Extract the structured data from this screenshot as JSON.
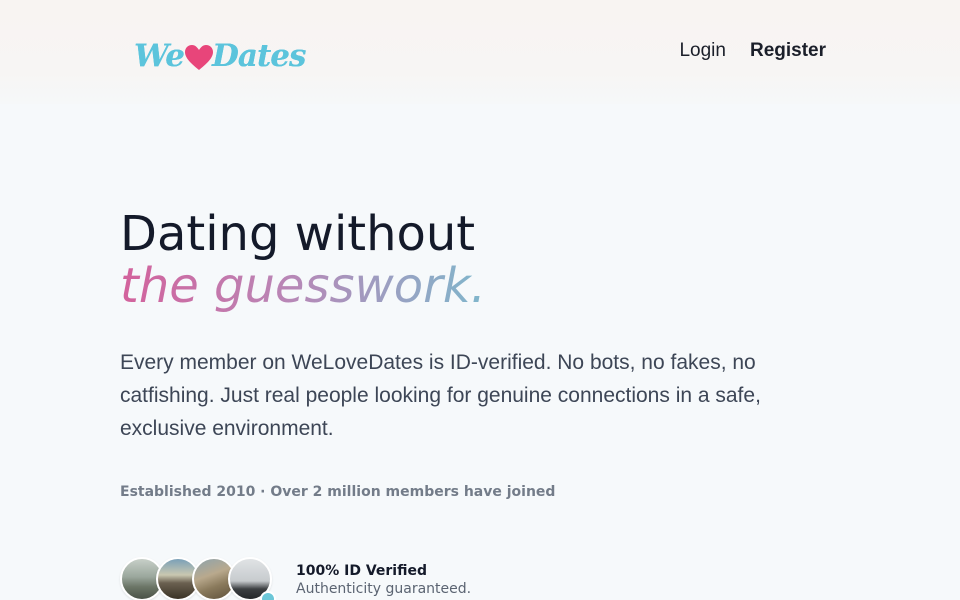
{
  "brand": {
    "logo_part1": "We",
    "logo_part2": "Dates",
    "heart_icon": "heart-icon",
    "colors": {
      "logo_blue": "#5cc4dc",
      "heart_pink": "#e8457a"
    }
  },
  "nav": {
    "login": "Login",
    "register": "Register"
  },
  "hero": {
    "title_line1": "Dating without",
    "title_line2": "the guesswork.",
    "gradient": [
      "#d3629c",
      "#b986b6",
      "#7fb7cc"
    ],
    "description": "Every member on WeLoveDates is ID-verified. No bots, no fakes, no catfishing. Just real people looking for genuine connections in a safe, exclusive environment.",
    "established": "Established 2010 · Over 2 million members have joined"
  },
  "verified": {
    "title": "100% ID Verified",
    "subtitle": "Authenticity guaranteed.",
    "avatars": [
      "avatar-1",
      "avatar-2",
      "avatar-3",
      "avatar-4"
    ]
  }
}
